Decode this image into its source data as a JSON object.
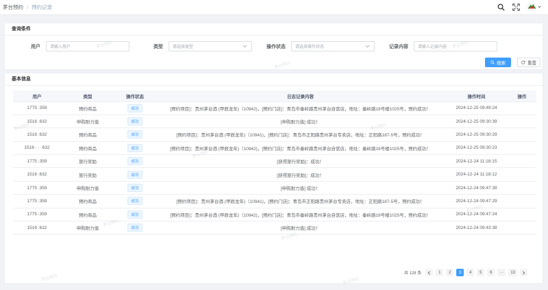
{
  "breadcrumb": {
    "root": "茅台预约",
    "separator": "/",
    "current": "预约记录"
  },
  "query_card": {
    "title": "查询条件",
    "user_label": "用户",
    "user_placeholder": "请输入用户",
    "type_label": "类型",
    "type_placeholder": "请选择类型",
    "status_label": "操作状态",
    "status_placeholder": "请选择操作状态",
    "content_label": "记录内容",
    "content_placeholder": "请输入记录内容",
    "search_label": "搜索",
    "reset_label": "重置"
  },
  "basic_card": {
    "title": "基本信息"
  },
  "table": {
    "headers": [
      "用户",
      "类型",
      "操作状态",
      "日志记录内容",
      "操作时间",
      "操作"
    ],
    "rows": [
      {
        "user": "1775  :359",
        "type": "预约商品",
        "status": "成功",
        "content": "[预约项目]：贵州茅台酒 (甲辰龙年)（10942)，[预约门店]：青岛市秦岭路贵州茅台自营店，地址：秦岭路19号楼1025号，预约成功！",
        "time": "2024-12-25 09:49:24"
      },
      {
        "user": "1516  :632",
        "type": "申购耐力值",
        "status": "成功",
        "content": "[申购耐力值] 成功！",
        "time": "2024-12-25 09:30:39"
      },
      {
        "user": "1516  :632",
        "type": "预约商品",
        "status": "成功",
        "content": "[预约项目]：贵州茅台酒 (甲辰龙年)（10941)，[预约门店]：青岛市正阳路贵州茅台专卖店，地址：正阳路187-5号，预约成功！",
        "time": "2024-12-25 09:30:29"
      },
      {
        "user": "1516 · · ·632",
        "type": "预约商品",
        "status": "成功",
        "content": "[预约项目]：贵州茅台酒 (甲辰龙年)（10942)，[预约门店]：青岛市秦岭路贵州茅台自营店，地址：秦岭路19号楼1025号，预约成功！",
        "time": "2024-12-25 09:30:23"
      },
      {
        "user": "1775  :359",
        "type": "旅行奖励",
        "status": "成功",
        "content": "[获得旅行奖励]：成功！",
        "time": "2024-12-24 11:18:15"
      },
      {
        "user": "1516  :632",
        "type": "旅行奖励",
        "status": "成功",
        "content": "[获得旅行奖励]：成功！",
        "time": "2024-12-24 11:18:12"
      },
      {
        "user": "1775  :359",
        "type": "申购耐力值",
        "status": "成功",
        "content": "[申购耐力值] 成功！",
        "time": "2024-12-24 09:47:39"
      },
      {
        "user": "1775  :359",
        "type": "预约商品",
        "status": "成功",
        "content": "[预约项目]：贵州茅台酒 (甲辰龙年)（10941)，[预约门店]：青岛市正阳路贵州茅台专卖店，地址：正阳路187-5号，预约成功！",
        "time": "2024-12-24 09:47:29"
      },
      {
        "user": "1775  :359",
        "type": "预约商品",
        "status": "成功",
        "content": "[预约项目]：贵州茅台酒 (甲辰龙年)（10942)，[预约门店]：青岛市秦岭路贵州茅台自营店，地址：秦岭路19号楼1025号，预约成功！",
        "time": "2024-12-24 09:47:24"
      },
      {
        "user": "1516  :632",
        "type": "申购耐力值",
        "status": "成功",
        "content": "[申购耐力值] 成功！",
        "time": "2024-12-24 09:43:38"
      }
    ]
  },
  "pagination": {
    "total": "共 128 条",
    "pages": [
      "1",
      "2",
      "3",
      "4",
      "5",
      "6",
      "···",
      "13"
    ],
    "current": "3"
  },
  "colors": {
    "primary": "#409eff",
    "tag_bg": "#ecf5ff"
  },
  "icons": [
    "search-icon",
    "fullscreen-icon",
    "logo-icon",
    "chevron-down-icon",
    "refresh-icon"
  ]
}
